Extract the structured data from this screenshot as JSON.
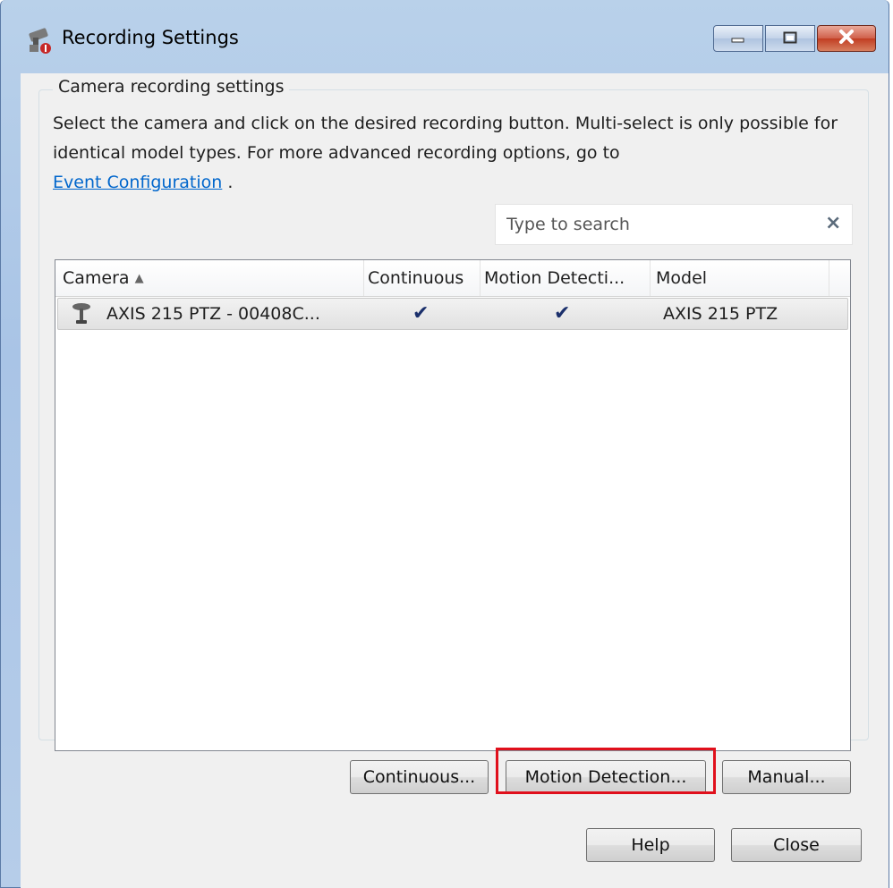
{
  "window": {
    "title": "Recording Settings"
  },
  "group": {
    "legend": "Camera recording settings",
    "description": "Select the camera and click on the desired recording button. Multi-select is only possible for identical model types. For more advanced recording options, go to",
    "link": "Event Configuration",
    "link_suffix": " ."
  },
  "search": {
    "placeholder": "Type to search",
    "value": "",
    "clear_icon": "×"
  },
  "grid": {
    "columns": [
      "Camera",
      "Continuous",
      "Motion Detecti...",
      "Model"
    ],
    "sort_indicator": "▲",
    "rows": [
      {
        "camera": "AXIS 215 PTZ - 00408C...",
        "continuous": "✔",
        "motion": "✔",
        "model": "AXIS 215 PTZ"
      }
    ]
  },
  "buttons": {
    "continuous": "Continuous...",
    "motion": "Motion Detection...",
    "manual": "Manual...",
    "help": "Help",
    "close": "Close"
  },
  "colors": {
    "highlight": "#e0101c",
    "link": "#0066cc",
    "checkmark": "#1a2f6b"
  }
}
